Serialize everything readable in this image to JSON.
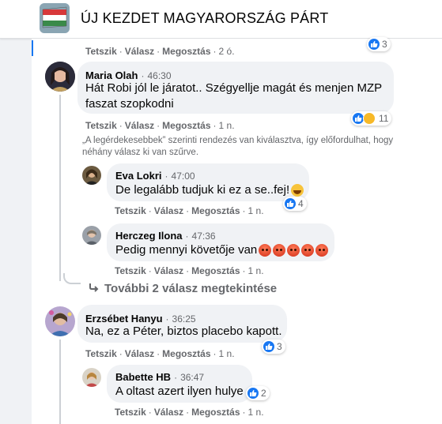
{
  "header": {
    "title": "ÚJ KEZDET MAGYARORSZÁG PÁRT"
  },
  "actions_labels": {
    "like": "Tetszik",
    "reply": "Válasz",
    "share": "Megosztás"
  },
  "top_action": {
    "time": "2 ó.",
    "reactions": "3"
  },
  "comments": [
    {
      "author": "Maria Olah",
      "time": "46:30",
      "text_line1": "Hát Robi jól le járatot.. Szégyellje magát és menjen MZP",
      "text_line2": "faszat szopkodni",
      "ago": "1 n.",
      "reactions": "11"
    },
    {
      "author": "Eva Lokri",
      "time": "47:00",
      "text": "De legalább tudjuk ki ez a se..fej!",
      "ago": "1 n.",
      "reactions": "4"
    },
    {
      "author": "Herczeg Ilona",
      "time": "47:36",
      "text": "Pedig mennyi követője van",
      "ago": "1 n."
    },
    {
      "author": "Erzsébet Hanyu",
      "time": "36:25",
      "text": "Na, ez a Péter, biztos placebo kapott.",
      "ago": "1 n.",
      "reactions": "3"
    },
    {
      "author": "Babette HB",
      "time": "36:47",
      "text": "A oltast azert ilyen hulye",
      "ago": "1 n.",
      "reactions": "2"
    }
  ],
  "sort_note": {
    "line1": "„A legérdekesebbek” szerinti rendezés van kiválasztva, így előfordulhat, hogy",
    "line2": "néhány válasz ki van szűrve."
  },
  "more_replies": "További 2 válasz megtekintése",
  "colors": {
    "like": "#1877f2",
    "meta": "#65676b",
    "bubble": "#f0f2f5"
  }
}
